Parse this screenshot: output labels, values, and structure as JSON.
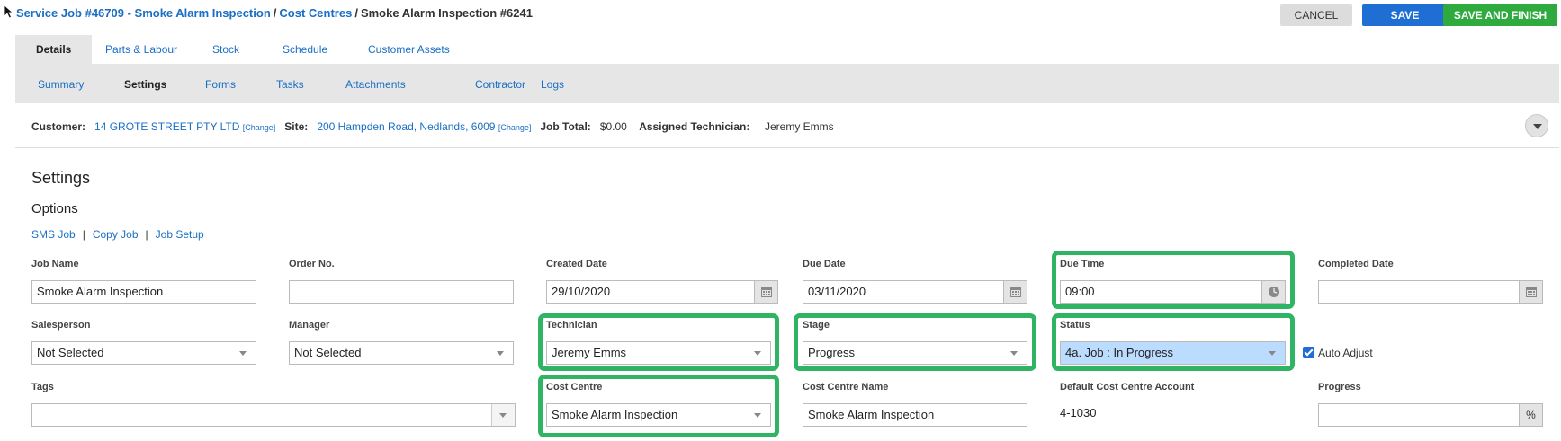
{
  "breadcrumb": {
    "job_link": "Service Job #46709 - Smoke Alarm Inspection",
    "cost_centres_link": "Cost Centres",
    "current": "Smoke Alarm Inspection #6241",
    "separator": "/"
  },
  "actions": {
    "cancel": "CANCEL",
    "save": "SAVE",
    "save_finish": "SAVE AND FINISH"
  },
  "tabs": [
    "Details",
    "Parts & Labour",
    "Stock",
    "Schedule",
    "Customer Assets"
  ],
  "active_tab": "Details",
  "subtabs": [
    "Summary",
    "Settings",
    "Forms",
    "Tasks",
    "Attachments",
    "Contractor",
    "Logs"
  ],
  "active_subtab": "Settings",
  "info": {
    "customer_label": "Customer:",
    "customer": "14 GROTE STREET PTY LTD",
    "change": "[Change]",
    "site_label": "Site:",
    "site": "200 Hampden Road, Nedlands, 6009",
    "job_total_label": "Job Total:",
    "job_total": "$0.00",
    "technician_label": "Assigned Technician:",
    "technician": "Jeremy Emms"
  },
  "settings_title": "Settings",
  "options_title": "Options",
  "option_links": [
    "SMS Job",
    "Copy Job",
    "Job Setup"
  ],
  "option_separator": "|",
  "fields": {
    "job_name": {
      "label": "Job Name",
      "value": "Smoke Alarm Inspection"
    },
    "order_no": {
      "label": "Order No.",
      "value": ""
    },
    "created_date": {
      "label": "Created Date",
      "value": "29/10/2020"
    },
    "due_date": {
      "label": "Due Date",
      "value": "03/11/2020"
    },
    "due_time": {
      "label": "Due Time",
      "value": "09:00"
    },
    "completed_date": {
      "label": "Completed Date",
      "value": ""
    },
    "salesperson": {
      "label": "Salesperson",
      "value": "Not Selected"
    },
    "manager": {
      "label": "Manager",
      "value": "Not Selected"
    },
    "technician": {
      "label": "Technician",
      "value": "Jeremy Emms"
    },
    "stage": {
      "label": "Stage",
      "value": "Progress"
    },
    "status": {
      "label": "Status",
      "value": "4a. Job : In Progress"
    },
    "auto_adjust": {
      "label": "Auto Adjust",
      "checked": true
    },
    "tags": {
      "label": "Tags",
      "value": ""
    },
    "cost_centre": {
      "label": "Cost Centre",
      "value": "Smoke Alarm Inspection"
    },
    "cost_centre_name": {
      "label": "Cost Centre Name",
      "value": "Smoke Alarm Inspection"
    },
    "default_account": {
      "label": "Default Cost Centre Account",
      "value": "4-1030"
    },
    "progress": {
      "label": "Progress",
      "value": "",
      "unit": "%"
    }
  },
  "colors": {
    "link": "#1a6fc4",
    "save": "#1e6ed3",
    "save_finish": "#2eaa3e",
    "highlight_box": "#2fb464",
    "status_selected": "#bcdcff"
  }
}
